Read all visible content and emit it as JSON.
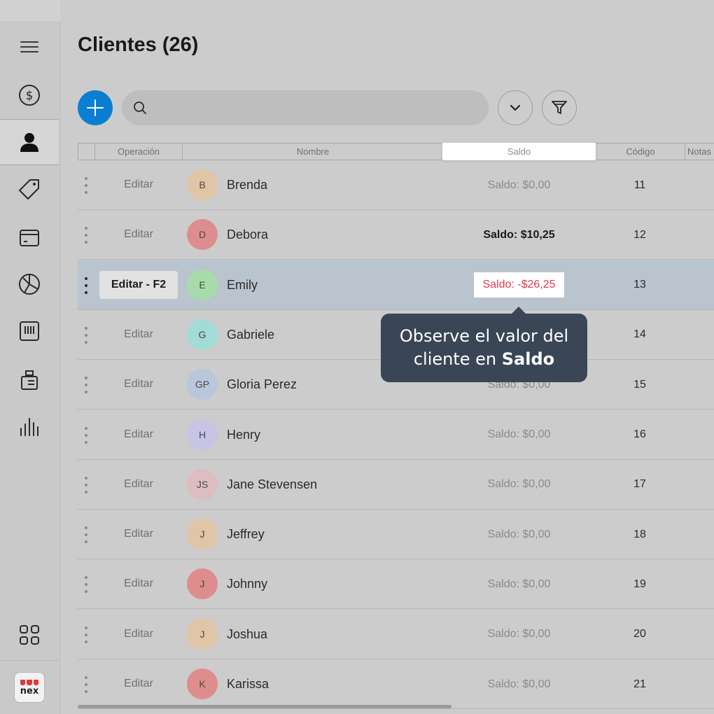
{
  "page": {
    "title": "Clientes (26)"
  },
  "sidebar": {
    "icons": [
      "menu-icon",
      "dollar-icon",
      "user-icon",
      "tag-icon",
      "box-icon",
      "chart-pie-icon",
      "barcode-icon",
      "register-icon",
      "bar-chart-icon",
      "apps-grid-icon"
    ],
    "logo_text": "nex"
  },
  "toolbar": {
    "search_placeholder": ""
  },
  "table": {
    "columns": {
      "operation": "Operación",
      "name": "Nombre",
      "saldo": "Saldo",
      "code": "Código",
      "notes": "Notas"
    },
    "rows": [
      {
        "edit": "Editar",
        "initials": "B",
        "name": "Brenda",
        "saldo": "Saldo: $0,00",
        "code": "11",
        "color": "#e2c4a6"
      },
      {
        "edit": "Editar",
        "initials": "D",
        "name": "Debora",
        "saldo": "Saldo: $10,25",
        "code": "12",
        "color": "#de8d8d"
      },
      {
        "edit": "Editar - F2",
        "initials": "E",
        "name": "Emily",
        "saldo": "Saldo: -$26,25",
        "code": "13",
        "color": "#a6dca9"
      },
      {
        "edit": "Editar",
        "initials": "G",
        "name": "Gabriele",
        "saldo": "",
        "code": "14",
        "color": "#a1dcd6"
      },
      {
        "edit": "Editar",
        "initials": "GP",
        "name": "Gloria Perez",
        "saldo": "Saldo: $0,00",
        "code": "15",
        "color": "#b9c6dc"
      },
      {
        "edit": "Editar",
        "initials": "H",
        "name": "Henry",
        "saldo": "Saldo: $0,00",
        "code": "16",
        "color": "#c8c4e6"
      },
      {
        "edit": "Editar",
        "initials": "JS",
        "name": "Jane Stevensen",
        "saldo": "Saldo: $0,00",
        "code": "17",
        "color": "#ddbdbf"
      },
      {
        "edit": "Editar",
        "initials": "J",
        "name": "Jeffrey",
        "saldo": "Saldo: $0,00",
        "code": "18",
        "color": "#e2c4a6"
      },
      {
        "edit": "Editar",
        "initials": "J",
        "name": "Johnny",
        "saldo": "Saldo: $0,00",
        "code": "19",
        "color": "#de8d8d"
      },
      {
        "edit": "Editar",
        "initials": "J",
        "name": "Joshua",
        "saldo": "Saldo: $0,00",
        "code": "20",
        "color": "#e2c4a6"
      },
      {
        "edit": "Editar",
        "initials": "K",
        "name": "Karissa",
        "saldo": "Saldo: $0,00",
        "code": "21",
        "color": "#de8d8d"
      }
    ]
  },
  "tooltip": {
    "line1": "Observe el valor del",
    "line2_prefix": "cliente en ",
    "line2_bold": "Saldo"
  },
  "colors": {
    "accent": "#0a7fd1",
    "negative": "#e03a4e",
    "tooltip_bg": "#3a4656"
  }
}
